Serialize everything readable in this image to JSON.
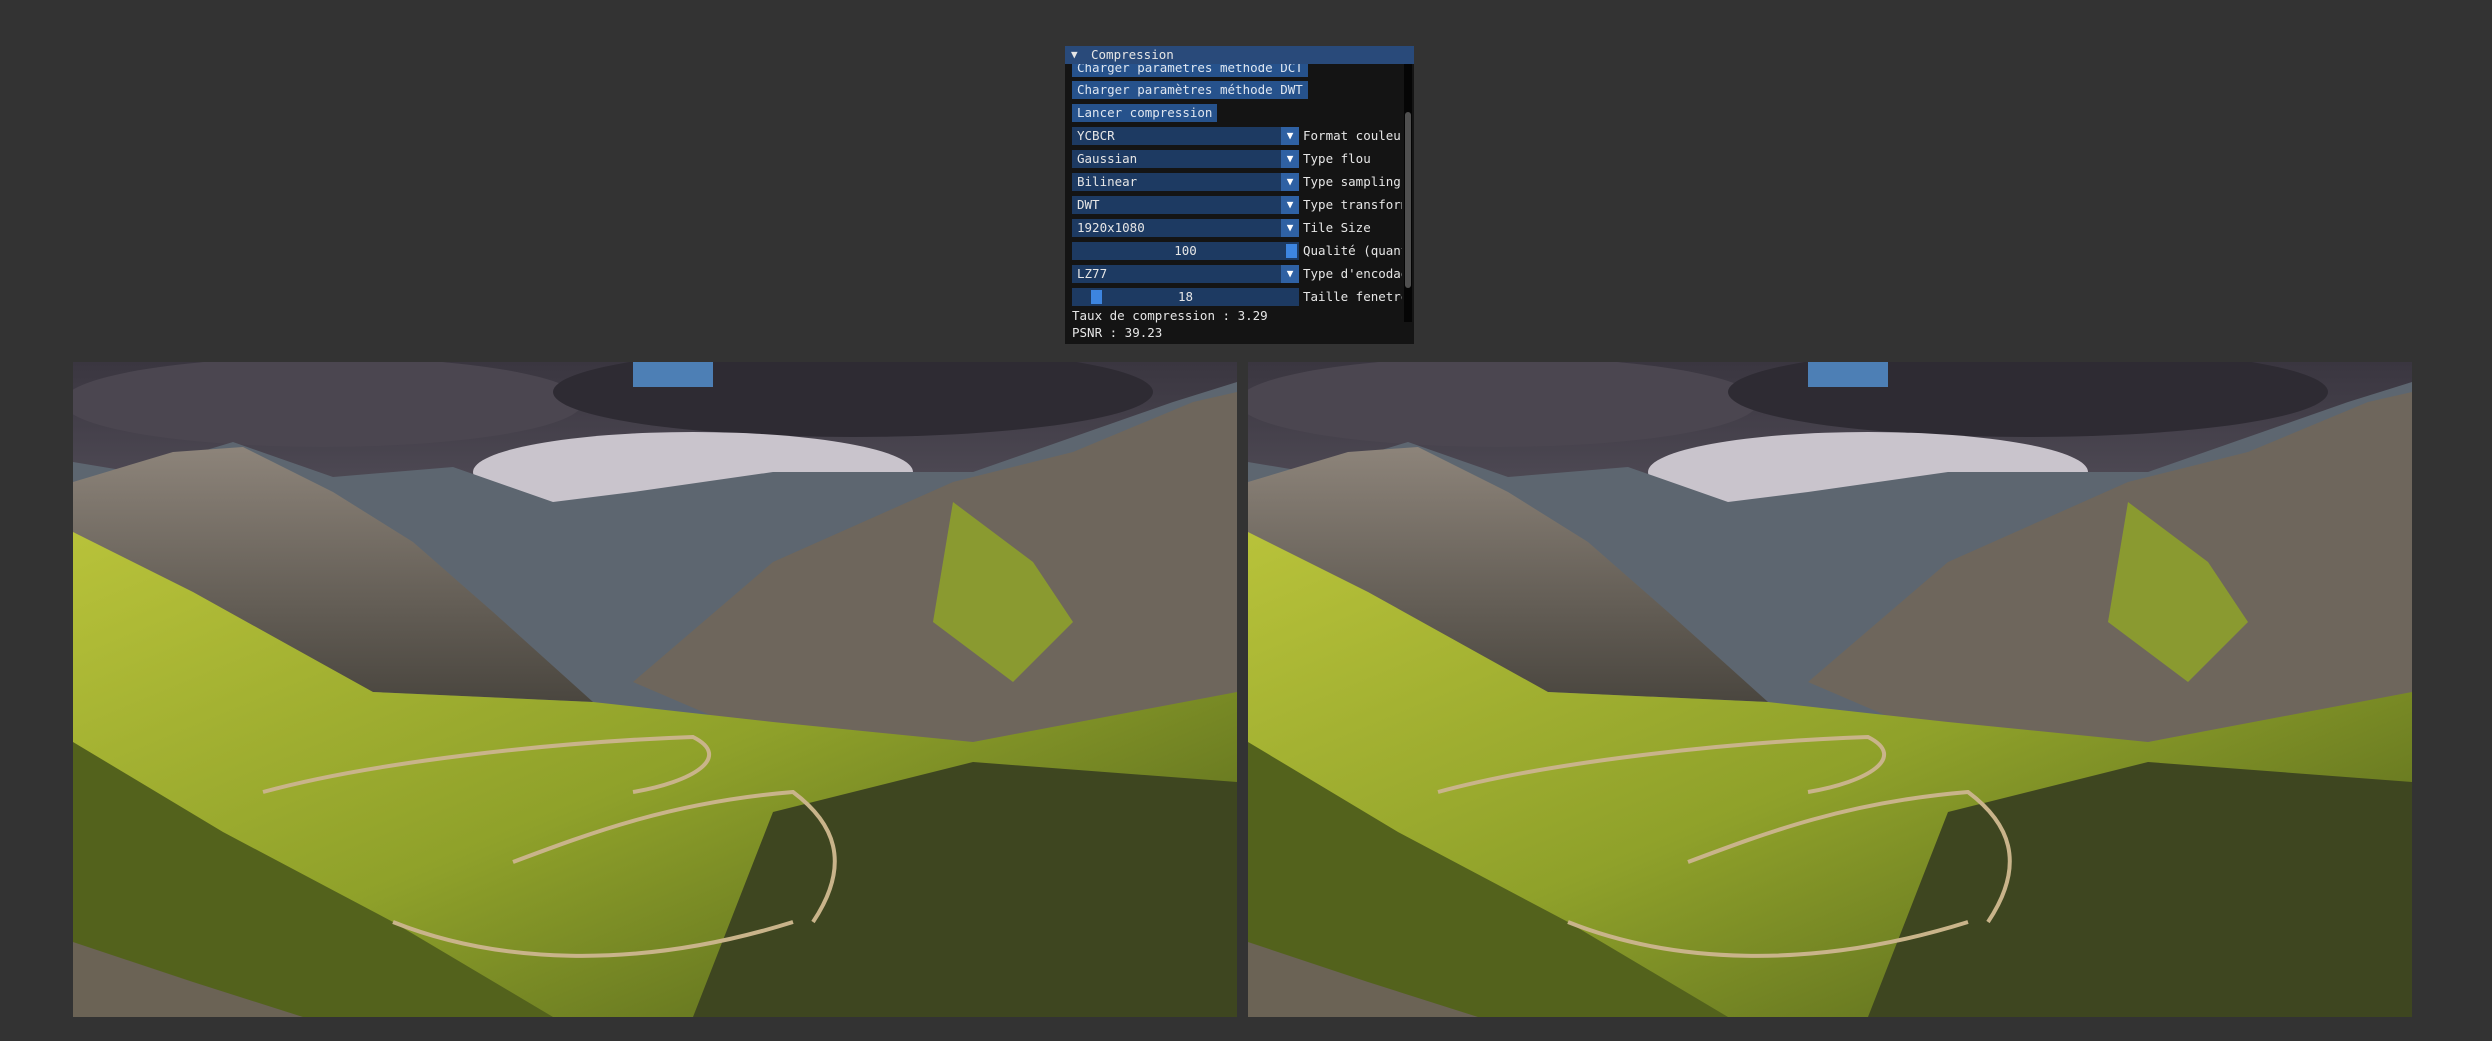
{
  "window": {
    "title": "Compression",
    "buttons": {
      "load_dct": "Charger paramètres méthode DCT",
      "load_dwt": "Charger paramètres méthode DWT",
      "run": "Lancer compression"
    },
    "rows": {
      "color_format": {
        "value": "YCBCR",
        "label": "Format couleur"
      },
      "blur_type": {
        "value": "Gaussian",
        "label": "Type flou"
      },
      "sampling_type": {
        "value": "Bilinear",
        "label": "Type sampling"
      },
      "transform_type": {
        "value": "DWT",
        "label": "Type transform"
      },
      "tile_size": {
        "value": "1920x1080",
        "label": "Tile Size"
      },
      "quality": {
        "value": "100",
        "label": "Qualité (quant",
        "fraction": 1.0
      },
      "encoding_type": {
        "value": "LZ77",
        "label": "Type d'encodag"
      },
      "window_size": {
        "value": "18",
        "label": "Taille fenetre",
        "fraction": 0.08
      }
    },
    "status": {
      "compression_ratio": "Taux de compression : 3.29",
      "psnr": "PSNR : 39.23"
    }
  },
  "images": {
    "original": "mountain-valley-photo",
    "compressed": "mountain-valley-photo"
  },
  "colors": {
    "background": "#333333",
    "title_bar": "#294a7a",
    "button": "#26528c",
    "frame": "#1d3a62",
    "accent": "#3d85e0"
  }
}
